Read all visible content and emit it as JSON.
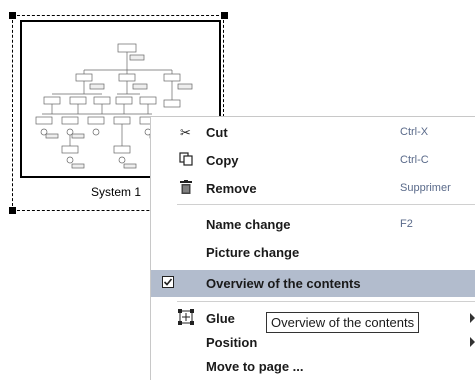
{
  "canvas_object": {
    "caption": "System 1"
  },
  "context_menu": {
    "items": [
      {
        "label": "Cut",
        "shortcut": "Ctrl-X",
        "icon": "scissors-icon"
      },
      {
        "label": "Copy",
        "shortcut": "Ctrl-C",
        "icon": "copy-icon"
      },
      {
        "label": "Remove",
        "shortcut": "Supprimer",
        "icon": "trash-icon"
      },
      {
        "label": "Name change",
        "shortcut": "F2"
      },
      {
        "label": "Picture change",
        "shortcut": ""
      },
      {
        "label": "Overview of the contents",
        "shortcut": "",
        "checked": true,
        "highlighted": true,
        "icon": "checkbox-icon"
      },
      {
        "label": "Glue",
        "shortcut": "",
        "submenu": true,
        "icon": "glue-icon"
      },
      {
        "label": "Position",
        "shortcut": "",
        "submenu": true
      },
      {
        "label": "Move to page ...",
        "shortcut": ""
      }
    ],
    "highlight_color": "#b2bccd"
  },
  "tooltip": {
    "text": "Overview of the contents"
  }
}
